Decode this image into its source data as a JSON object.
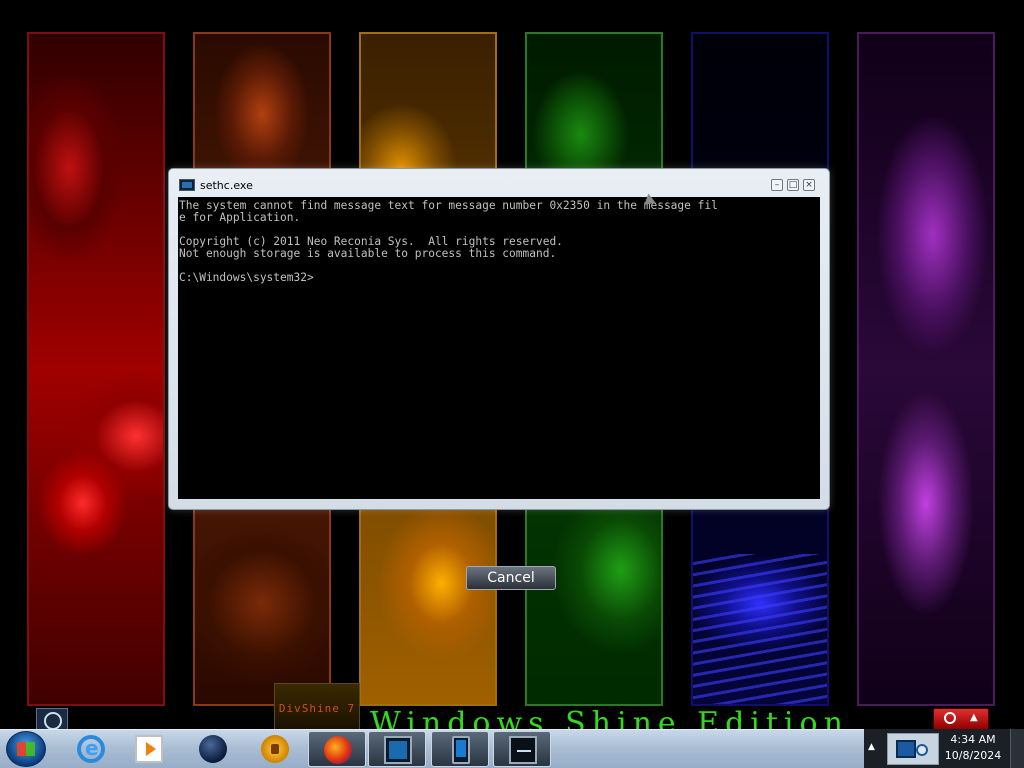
{
  "window": {
    "title": "sethc.exe",
    "min_glyph": "–",
    "max_glyph": "□",
    "close_glyph": "×"
  },
  "console": {
    "lines": [
      "The system cannot find message text for message number 0x2350 in the message fil",
      "e for Application.",
      "",
      "Copyright (c) 2011 Neo Reconia Sys.  All rights reserved.",
      "Not enough storage is available to process this command.",
      "",
      "C:\\Windows\\system32>"
    ]
  },
  "dialog": {
    "cancel_label": "Cancel"
  },
  "desktop": {
    "edition_text": "Windows Shine Edition",
    "badge_text": "DivShine 7"
  },
  "taskbar": {
    "items": [
      {
        "icon": "internet-explorer-icon",
        "active": false
      },
      {
        "icon": "media-player-icon",
        "active": false
      },
      {
        "icon": "globe-icon",
        "active": false
      },
      {
        "icon": "lock-icon",
        "active": false
      },
      {
        "icon": "firefox-icon",
        "active": true
      },
      {
        "icon": "command-prompt-icon",
        "active": true
      },
      {
        "icon": "tablet-icon",
        "active": true
      },
      {
        "icon": "monitor-icon",
        "active": true
      }
    ]
  },
  "tray": {
    "overflow_glyph": "▲",
    "time": "4:34 AM",
    "date": "10/8/2024"
  },
  "power": {
    "arrow_glyph": "▲"
  }
}
